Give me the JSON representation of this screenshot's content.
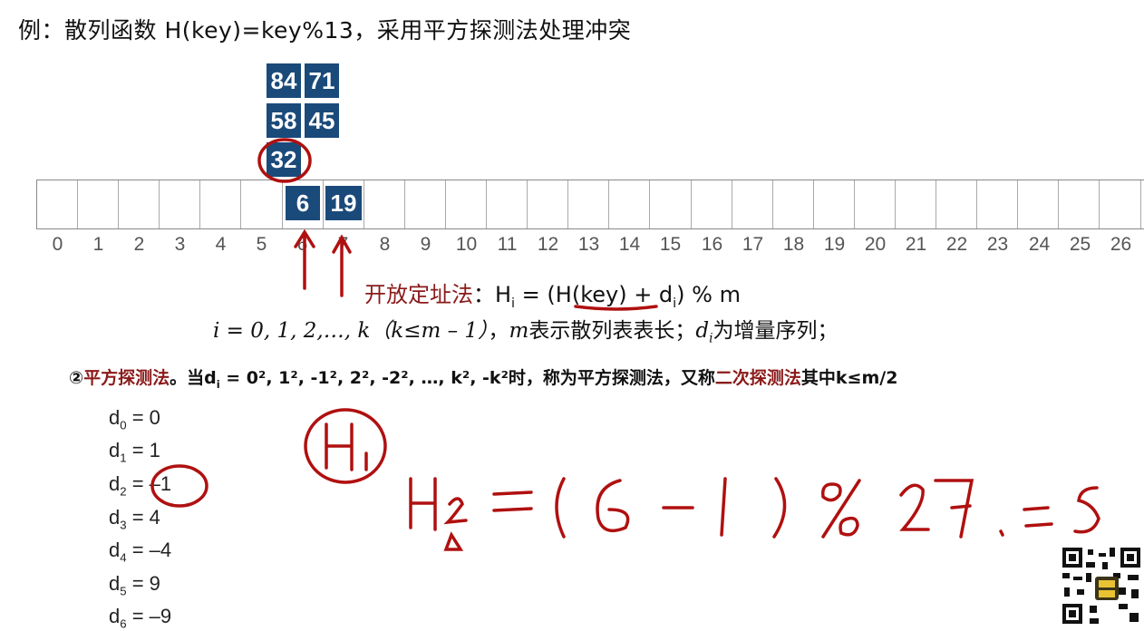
{
  "title": "例：散列函数 H(key)=key%13，采用平方探测法处理冲突",
  "stacked_boxes": [
    "84",
    "71",
    "58",
    "45",
    "32"
  ],
  "table_boxes": [
    "6",
    "19"
  ],
  "indices": [
    "0",
    "1",
    "2",
    "3",
    "4",
    "5",
    "6",
    "7",
    "8",
    "9",
    "10",
    "11",
    "12",
    "13",
    "14",
    "15",
    "16",
    "17",
    "18",
    "19",
    "20",
    "21",
    "22",
    "23",
    "24",
    "25",
    "26"
  ],
  "open_addr": {
    "label": "开放定址法",
    "sep": "：",
    "hi": "H",
    "hi_sub": "i",
    "eq_rest": " = (H(key) + d",
    "di_sub": "i",
    "mod": ") % m"
  },
  "condition": {
    "i_range": "i = 0, 1, 2,…, k（k≤m – 1）",
    "comma": "，",
    "m": "m",
    "m_text": "表示散列表表长；",
    "d": "d",
    "d_sub": "i",
    "d_text": "为增量序列；"
  },
  "method": {
    "num": "②",
    "name": "平方探测法",
    "mid1": "。当d",
    "sub_i": "i",
    "mid2": " = 0², 1², -1², 2², -2², …, k², -k²时，称为平方探测法，又称",
    "alt_name": "二次探测法",
    "end": "其中k≤m/2"
  },
  "d_list": [
    {
      "sub": "0",
      "val": " = 0"
    },
    {
      "sub": "1",
      "val": " = 1"
    },
    {
      "sub": "2",
      "val": " = –1"
    },
    {
      "sub": "3",
      "val": " = 4"
    },
    {
      "sub": "4",
      "val": " = –4"
    },
    {
      "sub": "5",
      "val": " = 9"
    },
    {
      "sub": "6",
      "val": " = –9"
    }
  ],
  "colors": {
    "box": "#1a4a7a",
    "accent_red": "#8b1a1a",
    "ink_red": "#b01010"
  }
}
